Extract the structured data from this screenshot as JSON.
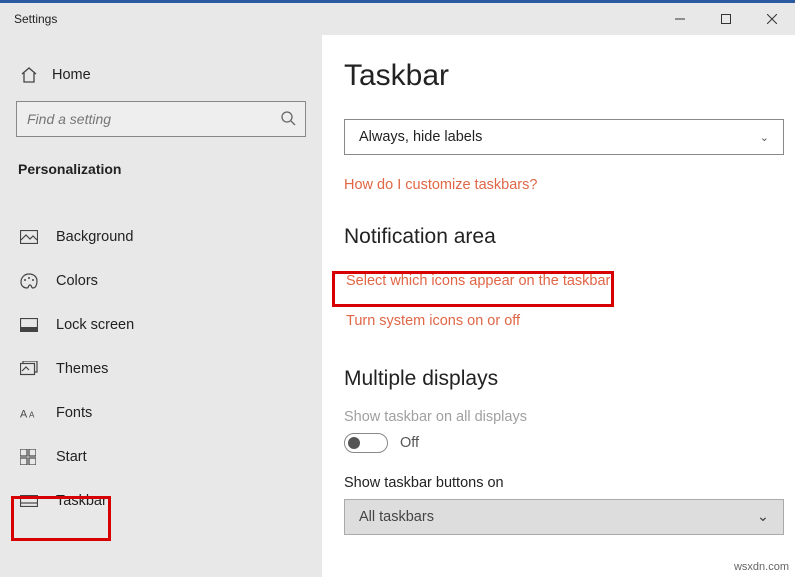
{
  "window": {
    "title": "Settings"
  },
  "sidebar": {
    "home": "Home",
    "search_placeholder": "Find a setting",
    "category": "Personalization",
    "items": [
      {
        "label": "Background"
      },
      {
        "label": "Colors"
      },
      {
        "label": "Lock screen"
      },
      {
        "label": "Themes"
      },
      {
        "label": "Fonts"
      },
      {
        "label": "Start"
      },
      {
        "label": "Taskbar"
      }
    ]
  },
  "main": {
    "title": "Taskbar",
    "combine_dropdown": "Always, hide labels",
    "help_link": "How do I customize taskbars?",
    "notification": {
      "heading": "Notification area",
      "link1": "Select which icons appear on the taskbar",
      "link2": "Turn system icons on or off"
    },
    "multiple": {
      "heading": "Multiple displays",
      "show_all_label": "Show taskbar on all displays",
      "toggle_state": "Off",
      "buttons_on_label": "Show taskbar buttons on",
      "buttons_on_value": "All taskbars"
    }
  },
  "watermark": "wsxdn.com"
}
